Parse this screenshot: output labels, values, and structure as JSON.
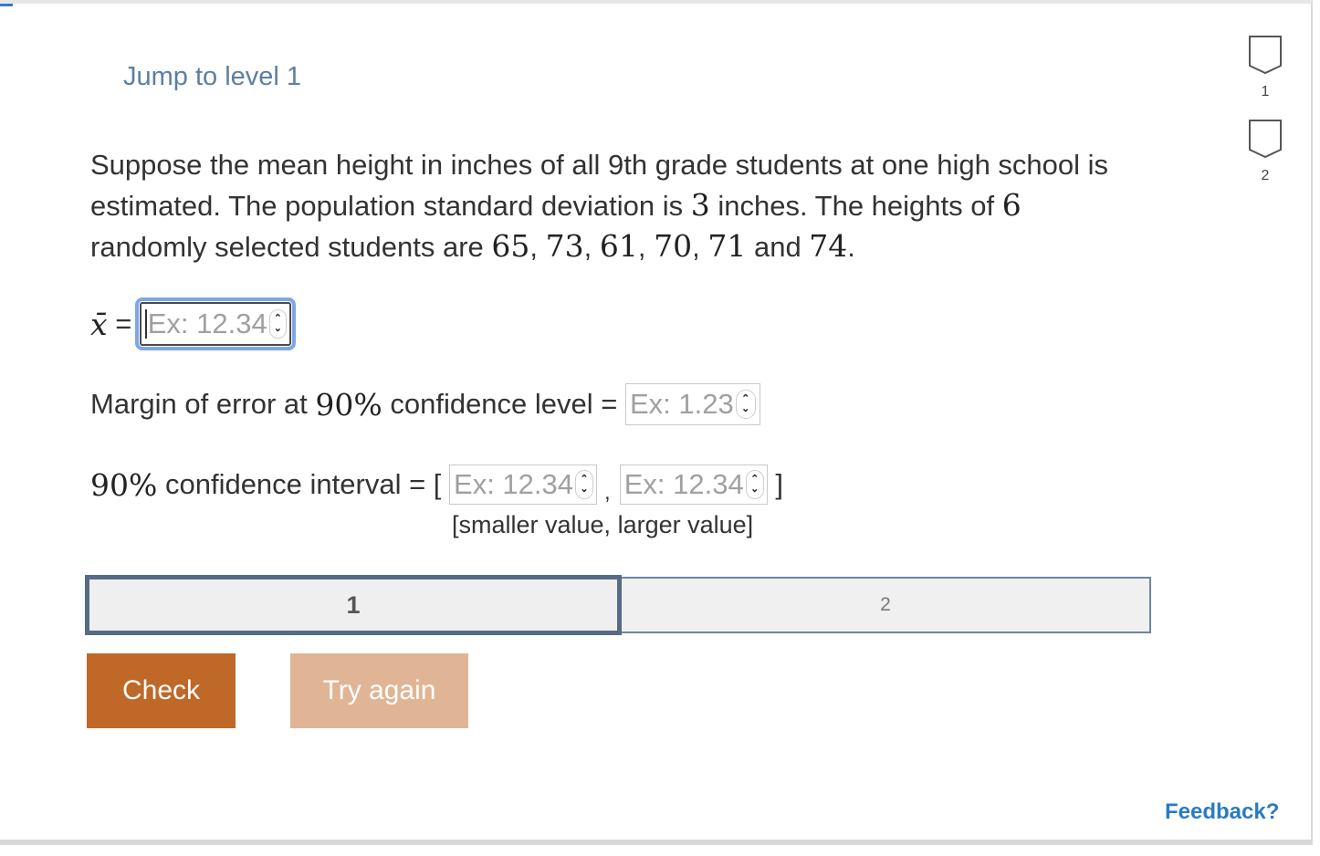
{
  "jump_link": "Jump to level 1",
  "problem": {
    "line1_text": "Suppose the mean height in inches of all 9th grade students at one high school is",
    "line2_a": "estimated. The population standard deviation is ",
    "sigma": "3",
    "line2_b": " inches. The heights of ",
    "n": "6",
    "line3_a": "randomly selected students are ",
    "h1": "65",
    "h2": "73",
    "h3": "61",
    "h4": "70",
    "h5": "71",
    "and": " and ",
    "h6": "74",
    "period": "."
  },
  "xbar": {
    "symbol": "x̄",
    "equals": " = ",
    "placeholder": "Ex: 12.34"
  },
  "margin": {
    "label_a": "Margin of error at ",
    "percent": "90%",
    "label_b": " confidence level = ",
    "placeholder": "Ex: 1.23"
  },
  "interval": {
    "percent": "90%",
    "label": " confidence interval = [ ",
    "lower_placeholder": "Ex: 12.34",
    "comma": ",",
    "upper_placeholder": "Ex: 12.34",
    "close": " ]",
    "hint": "[smaller value, larger value]"
  },
  "levels": [
    "1",
    "2"
  ],
  "buttons": {
    "check": "Check",
    "try_again": "Try again"
  },
  "side_nav": [
    "1",
    "2"
  ],
  "feedback": "Feedback?"
}
